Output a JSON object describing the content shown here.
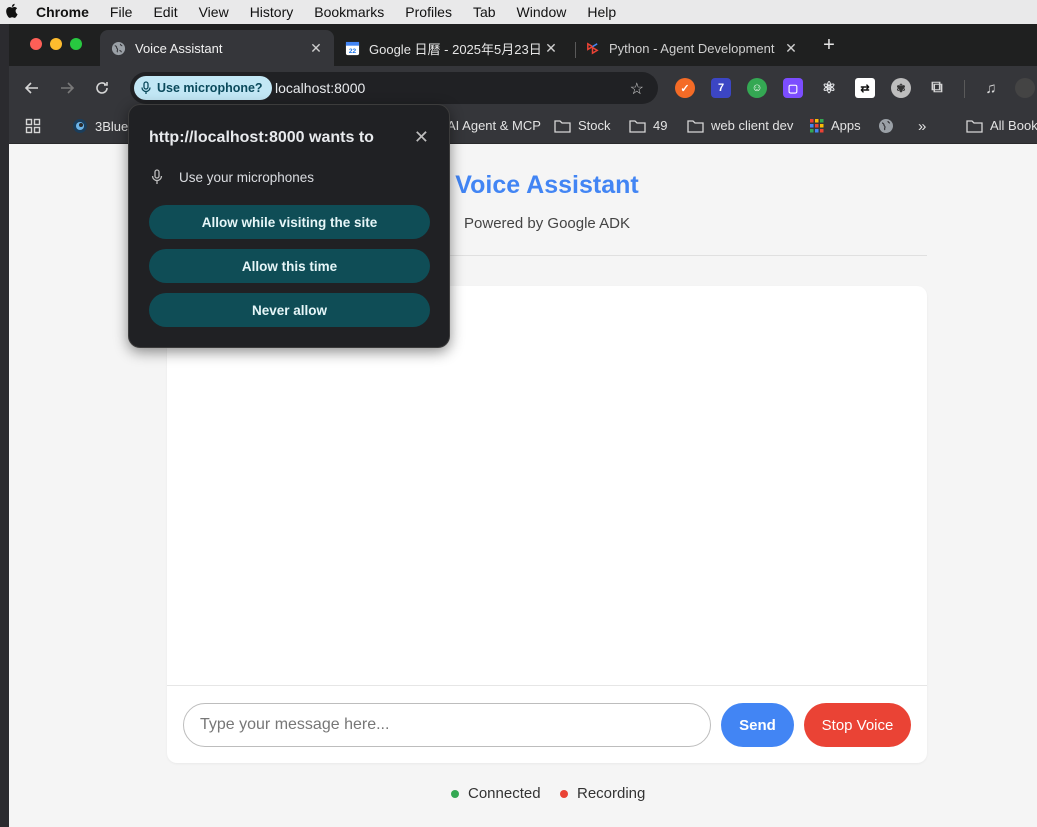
{
  "menubar": {
    "app": "Chrome",
    "items": [
      "File",
      "Edit",
      "View",
      "History",
      "Bookmarks",
      "Profiles",
      "Tab",
      "Window",
      "Help"
    ]
  },
  "tabs": [
    {
      "label": "Voice Assistant",
      "icon": "globe-icon",
      "active": true
    },
    {
      "label": "Google 日曆 - 2025年5月23日",
      "icon": "calendar-icon",
      "active": false
    },
    {
      "label": "Python - Agent Development",
      "icon": "adk-icon",
      "active": false
    }
  ],
  "omnibox": {
    "chip": "Use microphone?",
    "url": "localhost:8000"
  },
  "bookmarks": [
    {
      "label": "3Blue",
      "icon": "avatar-icon"
    },
    {
      "label": "AI Agent & MCP",
      "icon": "none"
    },
    {
      "label": "Stock",
      "icon": "folder-icon"
    },
    {
      "label": "49",
      "icon": "folder-icon"
    },
    {
      "label": "web client dev",
      "icon": "folder-icon"
    },
    {
      "label": "Apps",
      "icon": "apps-grid-icon"
    },
    {
      "label": "All Book",
      "icon": "folder-icon"
    }
  ],
  "popup": {
    "title": "http://localhost:8000 wants to",
    "permission": "Use your microphones",
    "allow_visit": "Allow while visiting the site",
    "allow_once": "Allow this time",
    "never": "Never allow"
  },
  "page": {
    "title": "Voice Assistant",
    "subtitle": "Powered by Google ADK",
    "input_placeholder": "Type your message here...",
    "send": "Send",
    "stop": "Stop Voice",
    "status_connected": "Connected",
    "status_recording": "Recording"
  },
  "colors": {
    "accent": "#4285f4",
    "stop": "#ea4335",
    "connected": "#34a853",
    "recording": "#ea4335"
  }
}
